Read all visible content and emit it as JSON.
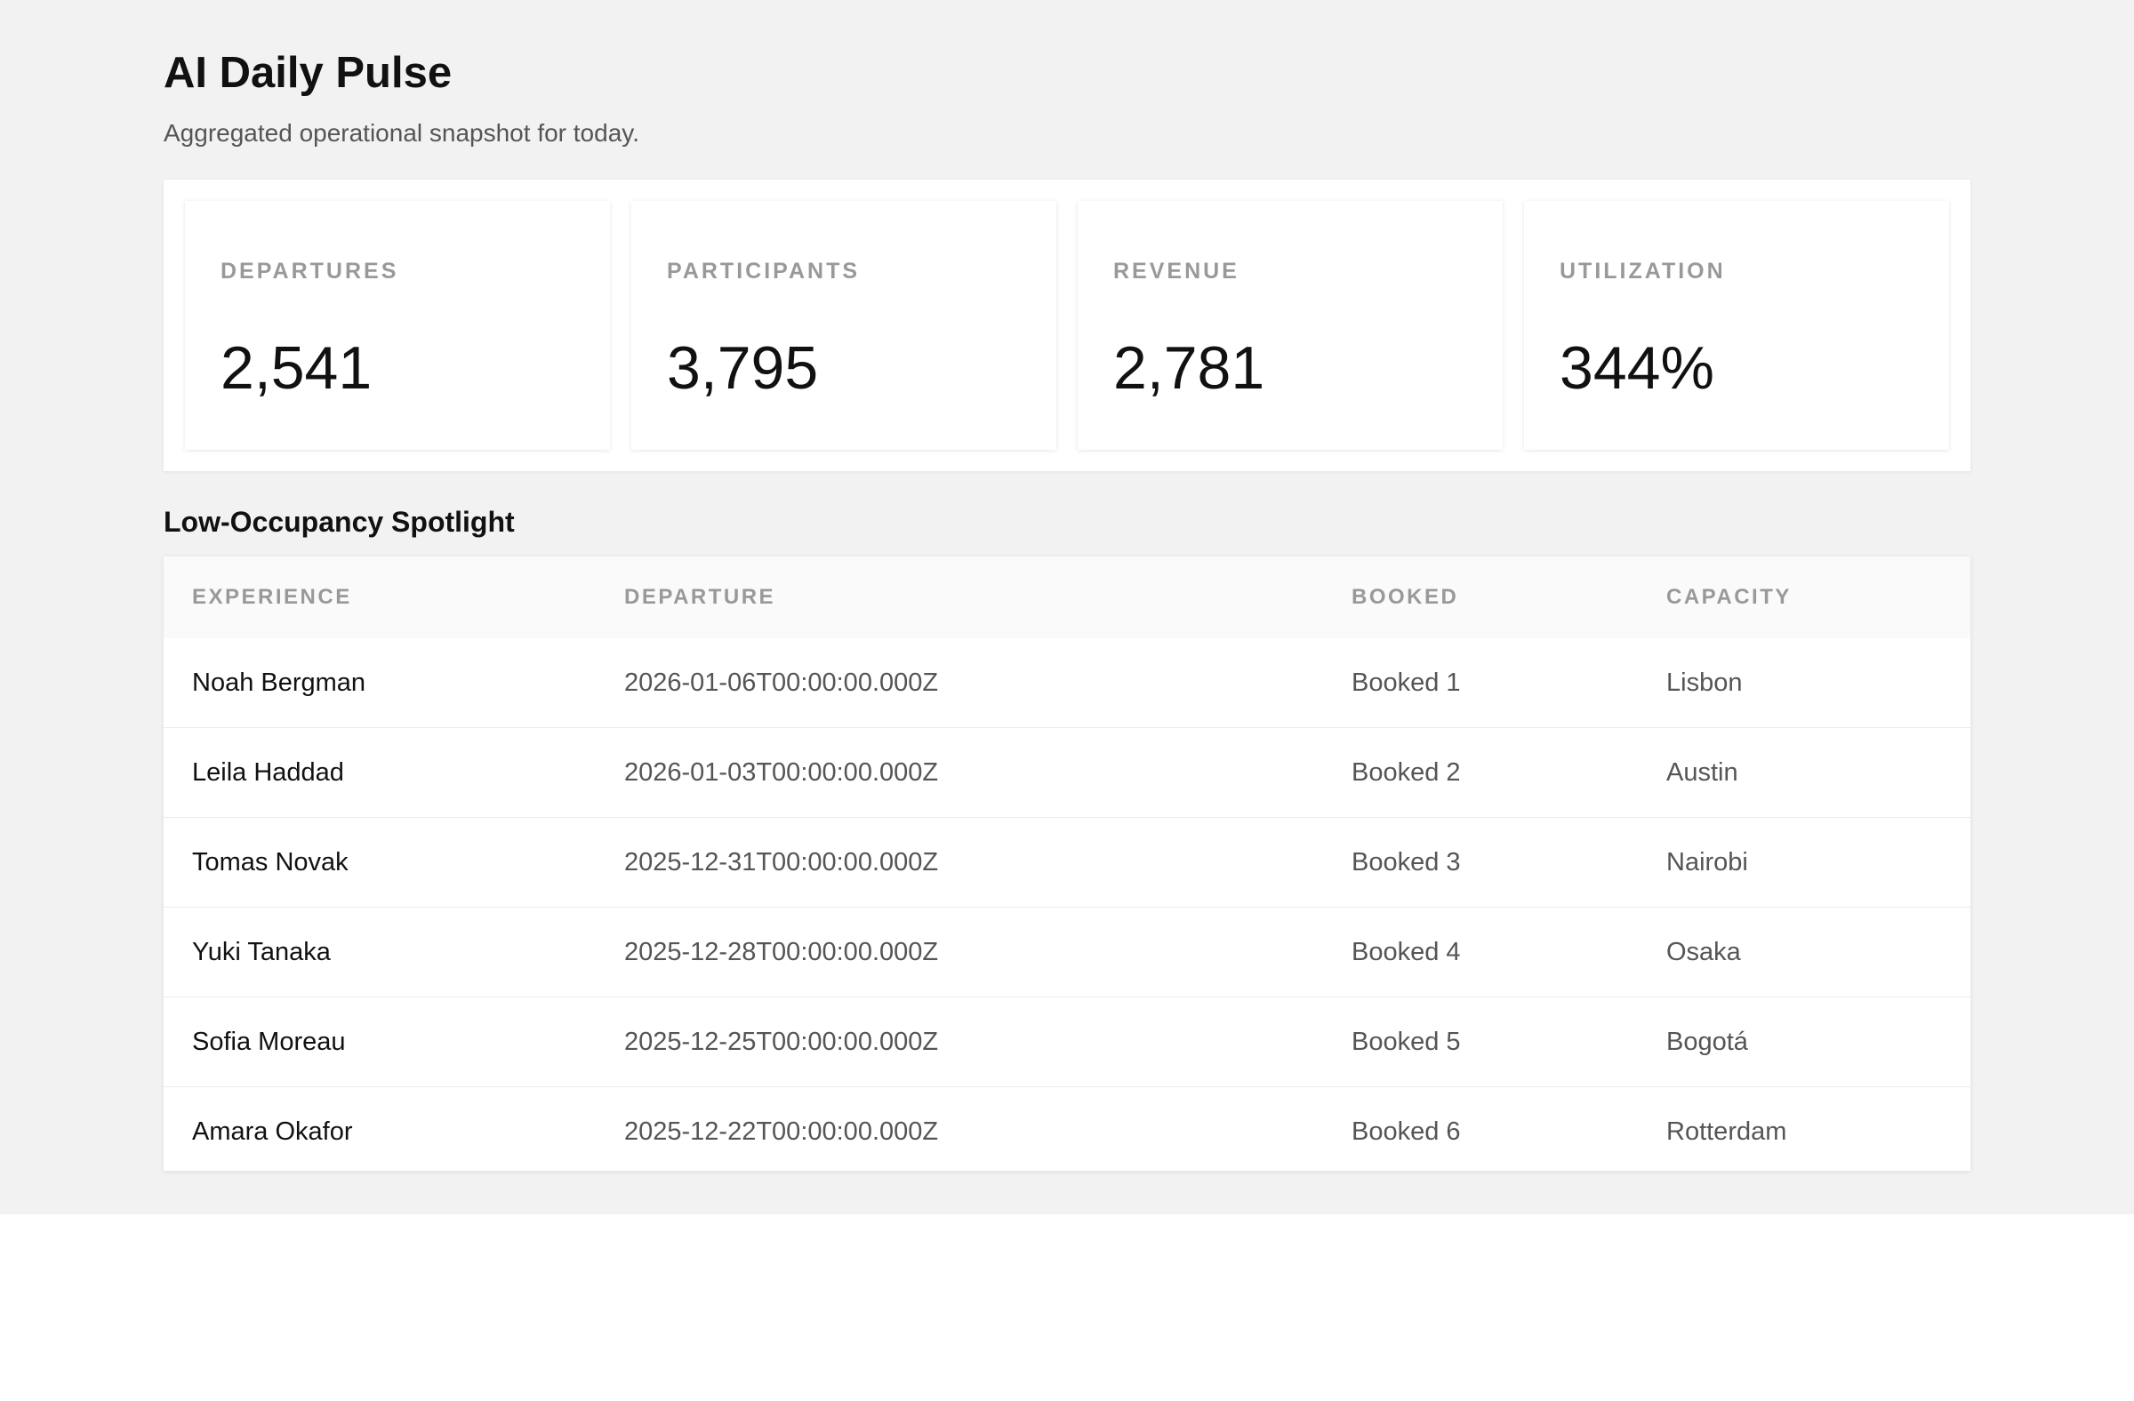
{
  "header": {
    "title": "AI Daily Pulse",
    "subtitle": "Aggregated operational snapshot for today."
  },
  "kpis": [
    {
      "label": "DEPARTURES",
      "value": "2,541"
    },
    {
      "label": "PARTICIPANTS",
      "value": "3,795"
    },
    {
      "label": "REVENUE",
      "value": "2,781"
    },
    {
      "label": "UTILIZATION",
      "value": "344%"
    }
  ],
  "spotlight": {
    "title": "Low-Occupancy Spotlight",
    "columns": [
      "EXPERIENCE",
      "DEPARTURE",
      "BOOKED",
      "CAPACITY"
    ],
    "rows": [
      {
        "experience": "Noah Bergman",
        "departure": "2026-01-06T00:00:00.000Z",
        "booked": "Booked 1",
        "capacity": "Lisbon"
      },
      {
        "experience": "Leila Haddad",
        "departure": "2026-01-03T00:00:00.000Z",
        "booked": "Booked 2",
        "capacity": "Austin"
      },
      {
        "experience": "Tomas Novak",
        "departure": "2025-12-31T00:00:00.000Z",
        "booked": "Booked 3",
        "capacity": "Nairobi"
      },
      {
        "experience": "Yuki Tanaka",
        "departure": "2025-12-28T00:00:00.000Z",
        "booked": "Booked 4",
        "capacity": "Osaka"
      },
      {
        "experience": "Sofia Moreau",
        "departure": "2025-12-25T00:00:00.000Z",
        "booked": "Booked 5",
        "capacity": "Bogotá"
      },
      {
        "experience": "Amara Okafor",
        "departure": "2025-12-22T00:00:00.000Z",
        "booked": "Booked 6",
        "capacity": "Rotterdam"
      }
    ]
  }
}
